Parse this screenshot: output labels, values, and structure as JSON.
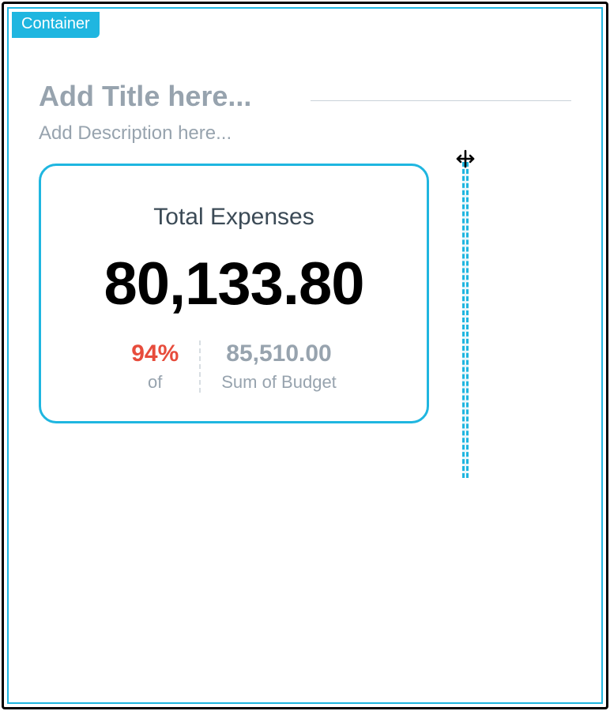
{
  "container": {
    "tag_label": "Container"
  },
  "header": {
    "title_placeholder": "Add Title here...",
    "title_value": "",
    "description_placeholder": "Add Description here...",
    "description_value": ""
  },
  "kpi_card": {
    "title": "Total Expenses",
    "value": "80,133.80",
    "percent_value": "94%",
    "percent_of_label": "of",
    "secondary_value": "85,510.00",
    "secondary_label": "Sum of Budget"
  },
  "colors": {
    "accent": "#1fb6e0",
    "muted": "#97a3ae",
    "danger": "#E74C3C"
  }
}
